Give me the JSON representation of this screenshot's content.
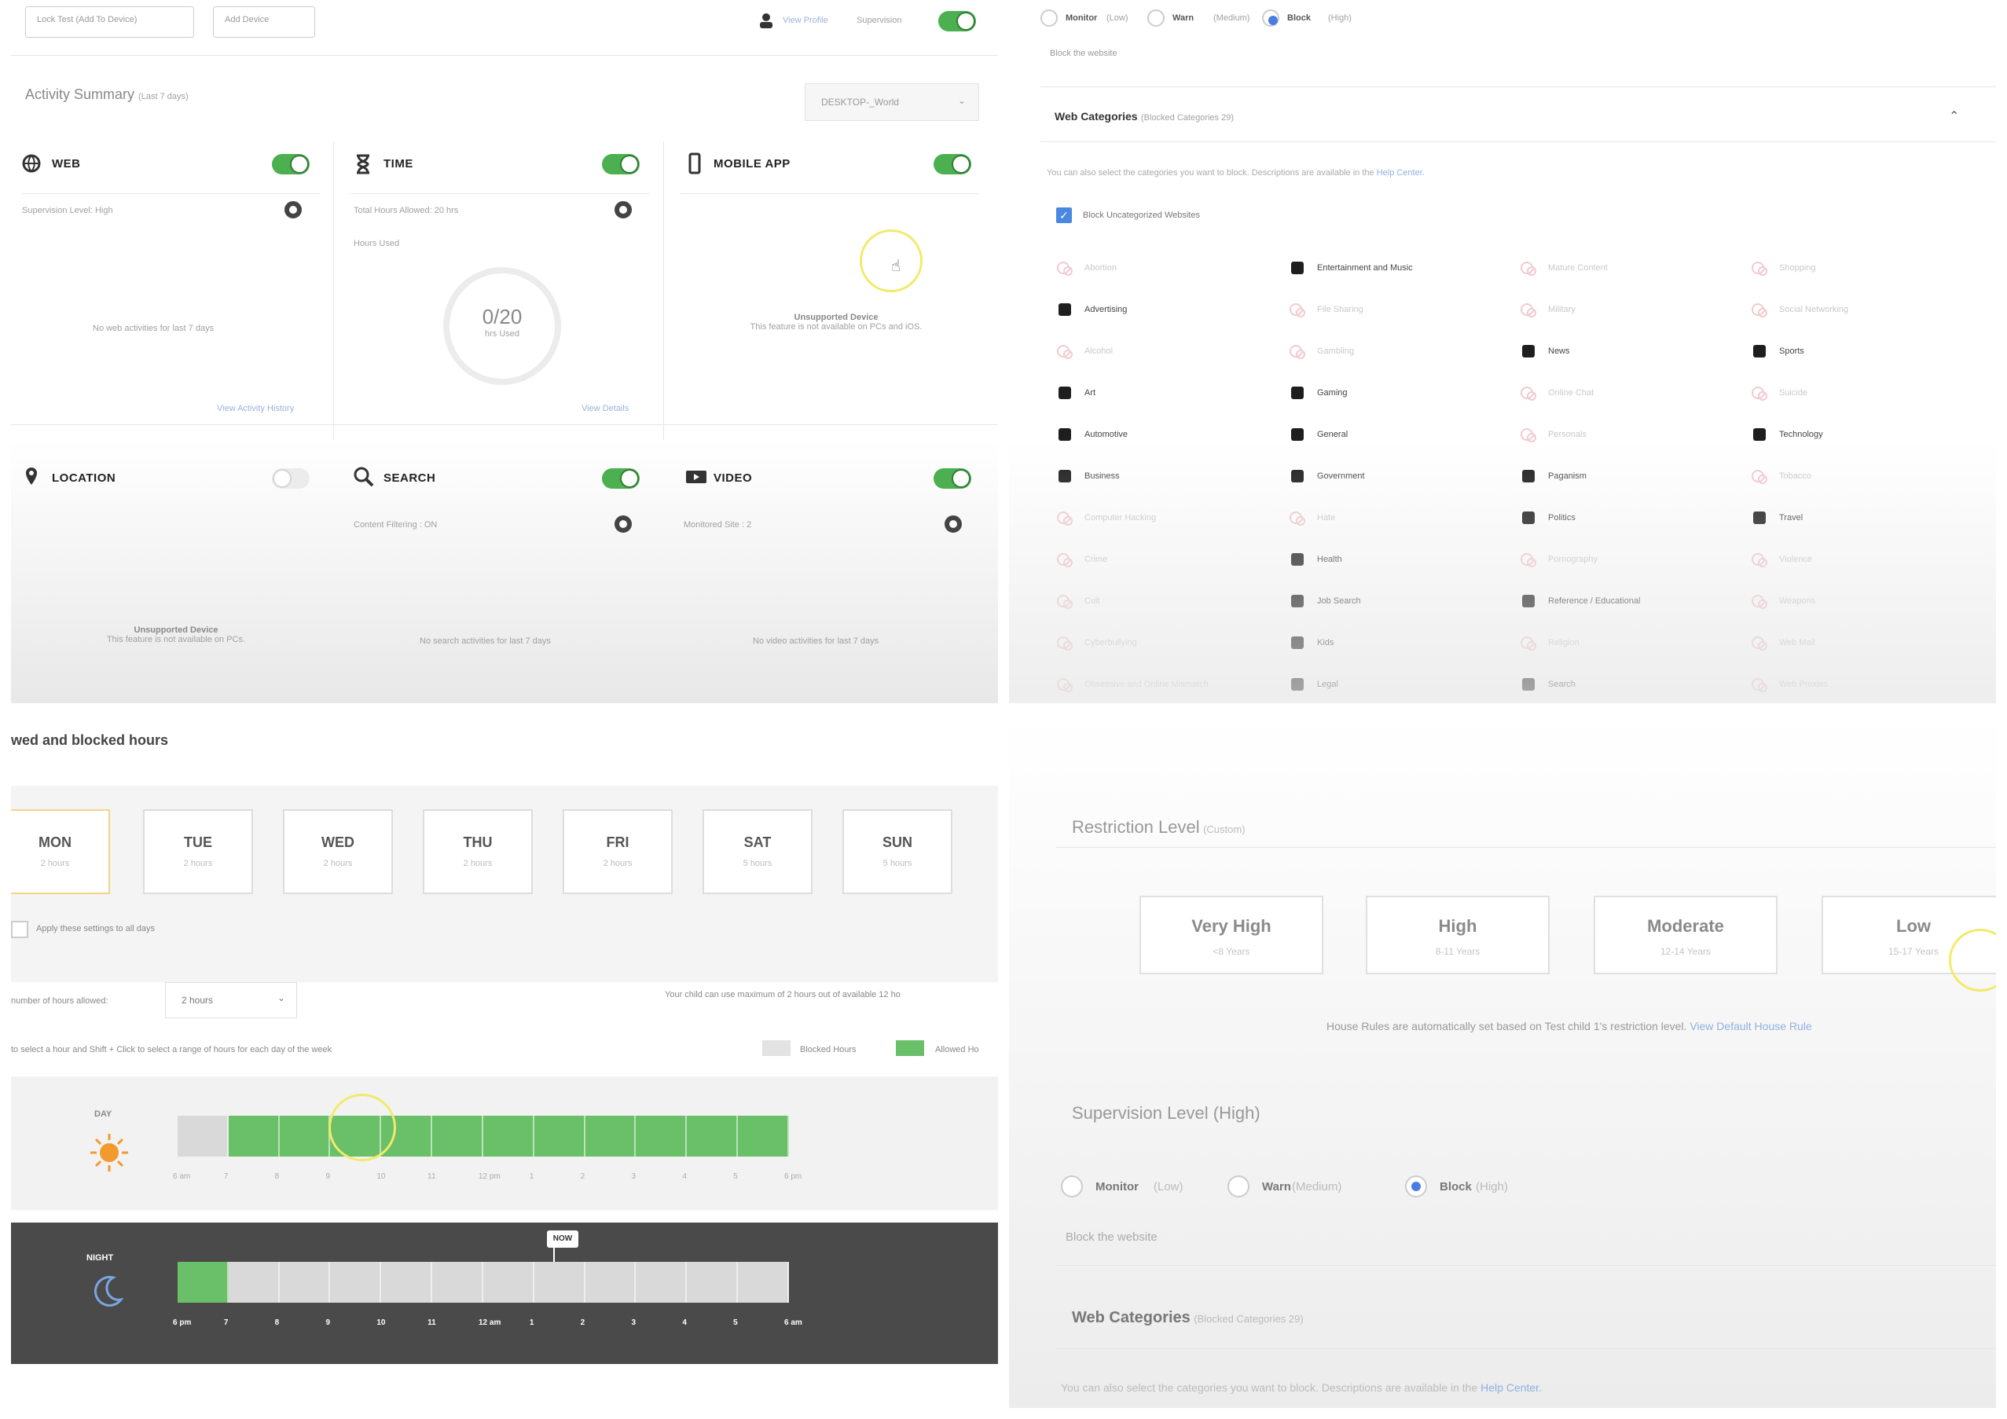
{
  "q1": {
    "top_buttons": [
      "Lock Test (Add To Device)",
      "Add Device"
    ],
    "view_profile": "View Profile",
    "supervision": "Supervision",
    "title": "Activity Summary",
    "title_sub": "(Last 7 days)",
    "device_select": "DESKTOP-_World",
    "web": {
      "label": "WEB",
      "line": "Supervision Level: High",
      "empty": "No web activities for last 7 days",
      "link": "View Activity History"
    },
    "time": {
      "label": "TIME",
      "line1": "Total Hours Allowed: 20 hrs",
      "line2": "Hours Used",
      "ring_value": "0/20",
      "ring_sub": "hrs Used",
      "link": "View Details"
    },
    "mobile": {
      "label": "MOBILE APP",
      "msg_title": "Unsupported Device",
      "msg": "This feature is not available on PCs and iOS."
    },
    "location": {
      "label": "LOCATION",
      "msg_title": "Unsupported Device",
      "msg": "This feature is not available on PCs."
    },
    "search": {
      "label": "SEARCH",
      "line": "Content Filtering : ON",
      "empty": "No search activities for last 7 days"
    },
    "video": {
      "label": "VIDEO",
      "line": "Monitored Site : 2",
      "empty": "No video activities for last 7 days"
    }
  },
  "q2": {
    "radios": [
      {
        "label": "Monitor",
        "sub": "(Low)"
      },
      {
        "label": "Warn",
        "sub": "(Medium)"
      },
      {
        "label": "Block",
        "sub": "(High)"
      }
    ],
    "radio_desc": "Block the website",
    "section_title": "Web Categories",
    "section_sub": "(Blocked Categories 29)",
    "help_text": "You can also select the categories you want to block. Descriptions are available in the",
    "help_link": "Help Center.",
    "uncat_label": "Block Uncategorized Websites",
    "columns": [
      [
        {
          "name": "Abortion",
          "blocked": true,
          "icon": "abortion-icon"
        },
        {
          "name": "Advertising",
          "blocked": false,
          "icon": "advertising-icon"
        },
        {
          "name": "Alcohol",
          "blocked": true,
          "icon": "alcohol-icon"
        },
        {
          "name": "Art",
          "blocked": false,
          "icon": "art-icon"
        },
        {
          "name": "Automotive",
          "blocked": false,
          "icon": "automotive-icon"
        },
        {
          "name": "Business",
          "blocked": false,
          "icon": "business-icon"
        },
        {
          "name": "Computer Hacking",
          "blocked": true,
          "icon": "hacking-icon"
        },
        {
          "name": "Crime",
          "blocked": true,
          "icon": "crime-icon"
        },
        {
          "name": "Cult",
          "blocked": true,
          "icon": "cult-icon"
        },
        {
          "name": "Cyberbullying",
          "blocked": true,
          "icon": "cyberbullying-icon"
        },
        {
          "name": "Obsessive and Online Mismatch",
          "blocked": true,
          "icon": "obsessive-icon"
        }
      ],
      [
        {
          "name": "Entertainment and Music",
          "blocked": false,
          "icon": "entertainment-icon"
        },
        {
          "name": "File Sharing",
          "blocked": true,
          "icon": "file-sharing-icon"
        },
        {
          "name": "Gambling",
          "blocked": true,
          "icon": "gambling-icon"
        },
        {
          "name": "Gaming",
          "blocked": false,
          "icon": "gaming-icon"
        },
        {
          "name": "General",
          "blocked": false,
          "icon": "general-icon"
        },
        {
          "name": "Government",
          "blocked": false,
          "icon": "government-icon"
        },
        {
          "name": "Hate",
          "blocked": true,
          "icon": "hate-icon"
        },
        {
          "name": "Health",
          "blocked": false,
          "icon": "health-icon"
        },
        {
          "name": "Job Search",
          "blocked": false,
          "icon": "job-search-icon"
        },
        {
          "name": "Kids",
          "blocked": false,
          "icon": "kids-icon"
        },
        {
          "name": "Legal",
          "blocked": false,
          "icon": "legal-icon"
        }
      ],
      [
        {
          "name": "Mature Content",
          "blocked": true,
          "icon": "mature-icon"
        },
        {
          "name": "Military",
          "blocked": true,
          "icon": "military-icon"
        },
        {
          "name": "News",
          "blocked": false,
          "icon": "news-icon"
        },
        {
          "name": "Online Chat",
          "blocked": true,
          "icon": "chat-icon"
        },
        {
          "name": "Personals",
          "blocked": true,
          "icon": "personals-icon"
        },
        {
          "name": "Paganism",
          "blocked": false,
          "icon": "paganism-icon"
        },
        {
          "name": "Politics",
          "blocked": false,
          "icon": "politics-icon"
        },
        {
          "name": "Pornography",
          "blocked": true,
          "icon": "pornography-icon"
        },
        {
          "name": "Reference / Educational",
          "blocked": false,
          "icon": "reference-icon"
        },
        {
          "name": "Religion",
          "blocked": true,
          "icon": "religion-icon"
        },
        {
          "name": "Search",
          "blocked": false,
          "icon": "search-icon"
        }
      ],
      [
        {
          "name": "Shopping",
          "blocked": true,
          "icon": "shopping-icon"
        },
        {
          "name": "Social Networking",
          "blocked": true,
          "icon": "social-icon"
        },
        {
          "name": "Sports",
          "blocked": false,
          "icon": "sports-icon"
        },
        {
          "name": "Suicide",
          "blocked": true,
          "icon": "suicide-icon"
        },
        {
          "name": "Technology",
          "blocked": false,
          "icon": "technology-icon"
        },
        {
          "name": "Tobacco",
          "blocked": true,
          "icon": "tobacco-icon"
        },
        {
          "name": "Travel",
          "blocked": false,
          "icon": "travel-icon"
        },
        {
          "name": "Violence",
          "blocked": true,
          "icon": "violence-icon"
        },
        {
          "name": "Weapons",
          "blocked": true,
          "icon": "weapons-icon"
        },
        {
          "name": "Web Mail",
          "blocked": true,
          "icon": "webmail-icon"
        },
        {
          "name": "Web Proxies",
          "blocked": true,
          "icon": "proxy-icon"
        }
      ]
    ]
  },
  "q3": {
    "heading": "wed and blocked hours",
    "days": [
      {
        "d": "MON",
        "h": "2 hours",
        "selected": true
      },
      {
        "d": "TUE",
        "h": "2 hours",
        "selected": false
      },
      {
        "d": "WED",
        "h": "2 hours",
        "selected": false
      },
      {
        "d": "THU",
        "h": "2 hours",
        "selected": false
      },
      {
        "d": "FRI",
        "h": "2 hours",
        "selected": false
      },
      {
        "d": "SAT",
        "h": "5 hours",
        "selected": false
      },
      {
        "d": "SUN",
        "h": "5 hours",
        "selected": false
      }
    ],
    "apply_all": "Apply these settings to all days",
    "hours_label": "number of hours allowed:",
    "hours_select": "2 hours",
    "max_note": "Your child can use maximum of 2 hours out of available 12 ho",
    "instructions": "to select a hour and Shift + Click to select a range of hours for each day of the week",
    "legend_blocked": "Blocked Hours",
    "legend_allowed": "Allowed Ho",
    "day_label": "DAY",
    "night_label": "NIGHT",
    "night_marker": "NOW",
    "day_ticks": [
      "6 am",
      "7",
      "8",
      "9",
      "10",
      "11",
      "12 pm",
      "1",
      "2",
      "3",
      "4",
      "5",
      "6 pm"
    ],
    "night_ticks": [
      "6 pm",
      "7",
      "8",
      "9",
      "10",
      "11",
      "12 am",
      "1",
      "2",
      "3",
      "4",
      "5",
      "6 am"
    ],
    "day_allowed": [
      false,
      true,
      true,
      true,
      true,
      true,
      true,
      true,
      true,
      true,
      true,
      true
    ],
    "night_allowed": [
      true,
      false,
      false,
      false,
      false,
      false,
      false,
      false,
      false,
      false,
      false,
      false
    ],
    "colors": {
      "allowed": "#6abf69",
      "blocked": "#d9d9d9",
      "night_bg": "#4a4a4a"
    }
  },
  "q4": {
    "restriction_title": "Restriction Level",
    "restriction_sub": "(Custom)",
    "levels": [
      {
        "t": "Very High",
        "s": "<8 Years"
      },
      {
        "t": "High",
        "s": "8-11 Years"
      },
      {
        "t": "Moderate",
        "s": "12-14 Years"
      },
      {
        "t": "Low",
        "s": "15-17 Years"
      }
    ],
    "house_rules": "House Rules are automatically set based on Test child 1's restriction level.",
    "house_rules_link": "View Default House Rule",
    "supervision_title": "Supervision Level (High)",
    "radios": [
      {
        "label": "Monitor",
        "sub": "(Low)"
      },
      {
        "label": "Warn",
        "sub": "(Medium)"
      },
      {
        "label": "Block",
        "sub": "(High)"
      }
    ],
    "radio_desc": "Block the website",
    "web_cat_title": "Web Categories",
    "web_cat_sub": "(Blocked Categories 29)",
    "help_text": "You can also select the categories you want to block. Descriptions are available in the",
    "help_link": "Help Center."
  }
}
